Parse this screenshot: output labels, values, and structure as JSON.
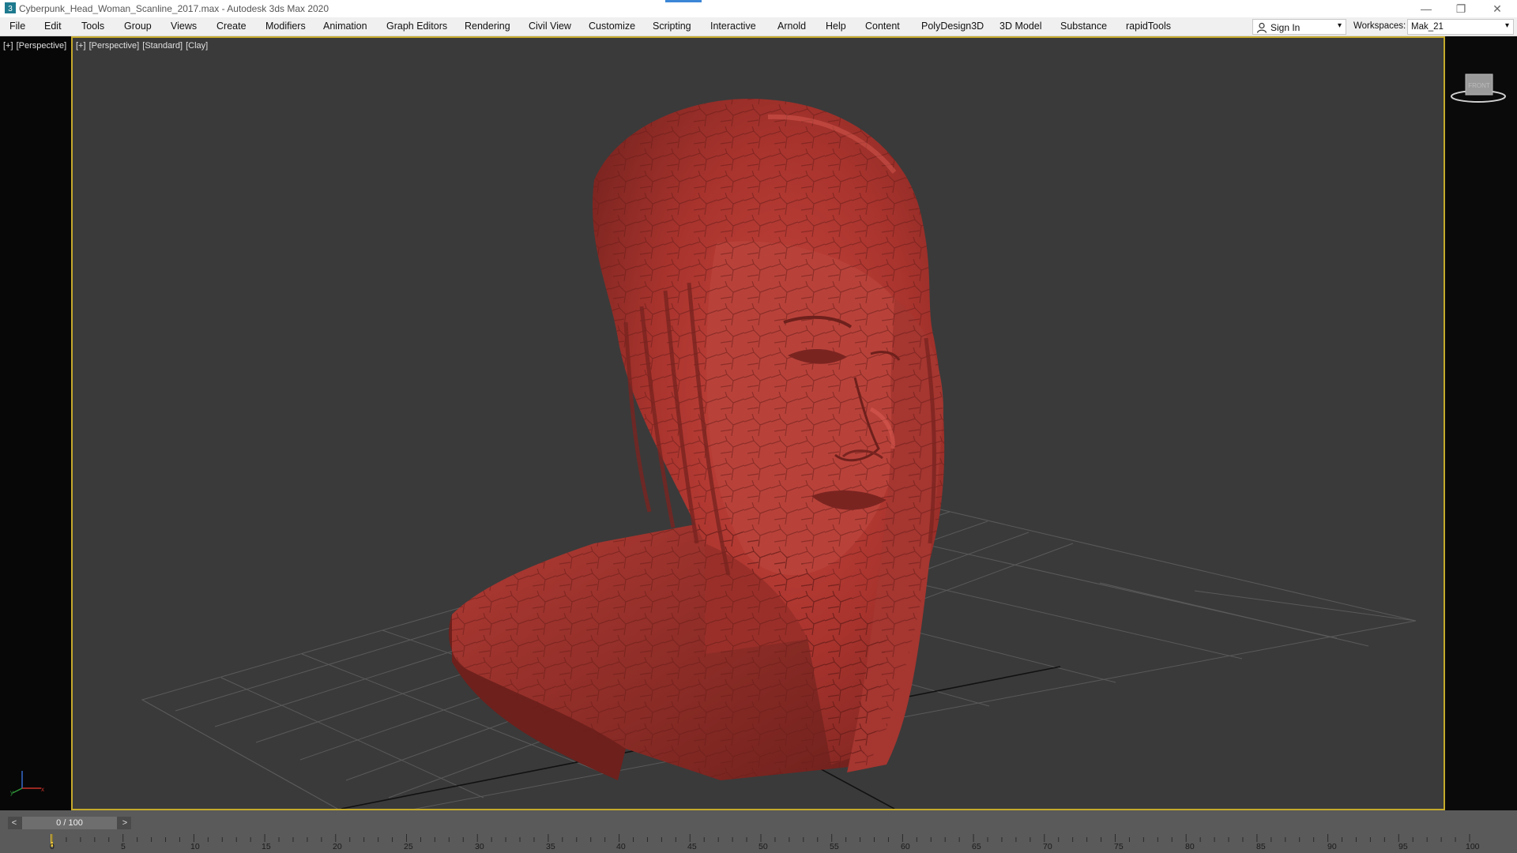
{
  "window": {
    "title": "Cyberpunk_Head_Woman_Scanline_2017.max - Autodesk 3ds Max 2020",
    "minimize_glyph": "—",
    "restore_glyph": "❐",
    "close_glyph": "✕"
  },
  "menubar": {
    "items": [
      "File",
      "Edit",
      "Tools",
      "Group",
      "Views",
      "Create",
      "Modifiers",
      "Animation",
      "Graph Editors",
      "Rendering",
      "Civil View",
      "Customize",
      "Scripting",
      "Interactive",
      "Arnold",
      "Help",
      "Content",
      "PolyDesign3D",
      "3D Model",
      "Substance",
      "rapidTools"
    ],
    "sign_in": "Sign In",
    "workspaces_label": "Workspaces:",
    "workspace_value": "Mak_21"
  },
  "viewport": {
    "label_plus": "[+]",
    "label_view": "[Perspective]",
    "label_shading": "[Standard]",
    "label_style": "[Clay]",
    "viewcube_text": "FRONT",
    "model_color": "#b03a33",
    "border_color": "#c5aa2c"
  },
  "timeline": {
    "frame_display": "0 / 100",
    "prev_glyph": "<",
    "next_glyph": ">",
    "ticks": [
      "0",
      "5",
      "10",
      "15",
      "20",
      "25",
      "30",
      "35",
      "40",
      "45",
      "50",
      "55",
      "60",
      "65",
      "70",
      "75",
      "80",
      "85",
      "90",
      "95",
      "100"
    ]
  },
  "icons": {
    "app": "3dsmax-app-icon",
    "user": "user-icon",
    "axis": "axis-tripod-icon",
    "viewcube": "viewcube-icon"
  }
}
